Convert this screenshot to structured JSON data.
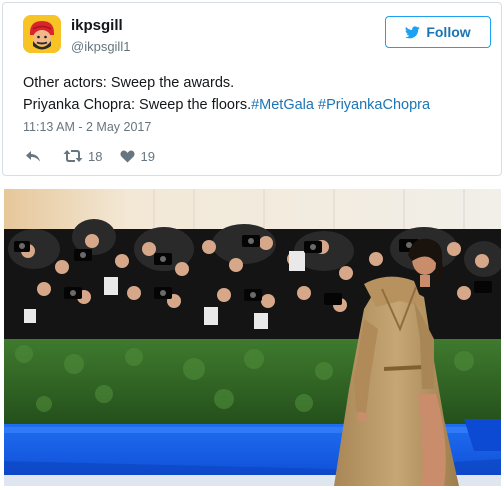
{
  "tweet": {
    "display_name": "ikpsgill",
    "handle": "@ikpsgill1",
    "follow_label": "Follow",
    "text_line1": "Other actors: Sweep the awards.",
    "text_line2_prefix": "Priyanka Chopra: Sweep the floors.",
    "hashtags": [
      "#MetGala",
      "#PriyankaChopra"
    ],
    "timestamp": "11:13 AM - 2 May 2017",
    "retweets": "18",
    "likes": "19"
  },
  "icons": {
    "avatar": "turban-avatar",
    "follow": "twitter-bird-icon",
    "reply": "reply-icon",
    "retweet": "retweet-icon",
    "like": "heart-icon"
  },
  "colors": {
    "link": "#1b75b5",
    "follow_border": "#1da1f2",
    "secondary_text": "#66757f",
    "avatar_bg": "#f7c325"
  }
}
